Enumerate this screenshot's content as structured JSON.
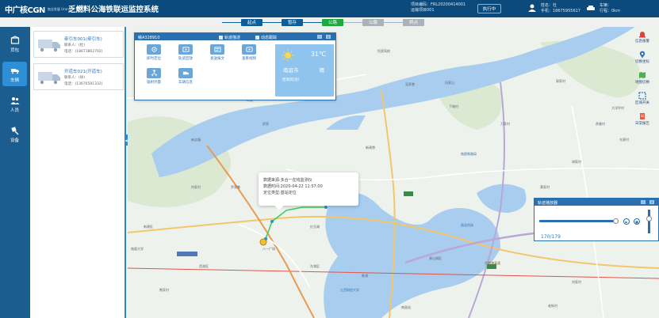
{
  "header": {
    "logo_text": "中广核CGN",
    "logo_sub": "铀业发展 Uranium Devt.",
    "title": "乏燃料公海铁联运监控系统",
    "project_code": "项目编码：FRL20200414001",
    "transport_id": "运输项目001",
    "exec_label": "执行中",
    "user_name": "姓名：杜",
    "user_phone": "手机：18675955617",
    "car_label": "车辆：",
    "mileage": "行程：0km"
  },
  "steps": [
    {
      "label": "起点",
      "state": "done"
    },
    {
      "label": "暂存",
      "state": "done"
    },
    {
      "label": "公路",
      "state": "active"
    },
    {
      "label": "公路",
      "state": "pending"
    },
    {
      "label": "终点",
      "state": "pending"
    }
  ],
  "nav": [
    {
      "label": "货包",
      "icon": "box-icon"
    },
    {
      "label": "车辆",
      "icon": "truck-icon"
    },
    {
      "label": "人员",
      "icon": "people-icon"
    },
    {
      "label": "设备",
      "icon": "device-icon"
    }
  ],
  "vehicles": [
    {
      "name": "牵引车001(牵引车)",
      "contact": "联系人：(杜)",
      "phone": "电话：(18673862792)"
    },
    {
      "name": "开道车021(开道车)",
      "contact": "联系人：(徐)",
      "phone": "电话：(13676591332)"
    }
  ],
  "vehicle_panel": {
    "plate": "赣A328910",
    "chk_track": "轨迹描述",
    "chk_follow": "动态跟踪",
    "buttons": [
      {
        "label": "即时定位",
        "icon": "locate-icon"
      },
      {
        "label": "轨迹回放",
        "icon": "playback-icon"
      },
      {
        "label": "发送报文",
        "icon": "message-icon"
      },
      {
        "label": "查看视频",
        "icon": "video-icon"
      },
      {
        "label": "辐射剂量",
        "icon": "radiation-icon"
      },
      {
        "label": "车辆信息",
        "icon": "vehicle-info-icon"
      }
    ],
    "weather": {
      "temp": "31℃",
      "city": "南昌市",
      "condition": "晴",
      "wind": "西南风[逆]"
    }
  },
  "popup": {
    "line1": "数据来源:多合一在线监测仪",
    "line2": "数据时间:2020-04-22 11:57:00",
    "line3": "定位类型:基站定位"
  },
  "right_tools": [
    {
      "label": "信息报警",
      "icon": "alarm-icon"
    },
    {
      "label": "切换坐标",
      "icon": "location-icon"
    },
    {
      "label": "地图切换",
      "icon": "map-switch-icon"
    },
    {
      "label": "区域开关",
      "icon": "area-icon"
    },
    {
      "label": "日常报告",
      "icon": "report-icon"
    }
  ],
  "playback": {
    "title": "轨迹播放器",
    "count": "170/179",
    "progress": 0.95
  },
  "map_labels": [
    "恒昌驾校",
    "伍家山",
    "老八家",
    "下城村",
    "新建港",
    "舒家",
    "新店镇",
    "邓家",
    "郭家村",
    "贵春村",
    "万家村",
    "胡家村",
    "东营村",
    "黄家村",
    "樵舍镇",
    "南昌铁路局",
    "昌北机场",
    "大洋坪村",
    "熊家村",
    "何家村",
    "红谷滩",
    "八一广场",
    "南昌站",
    "南昌大学",
    "江西财经大学",
    "象湖",
    "东湖区",
    "西湖区",
    "青山湖区",
    "老街村",
    "新建区",
    "罗家集",
    "刘家村",
    "吴家巷",
    "京港澳高速"
  ]
}
